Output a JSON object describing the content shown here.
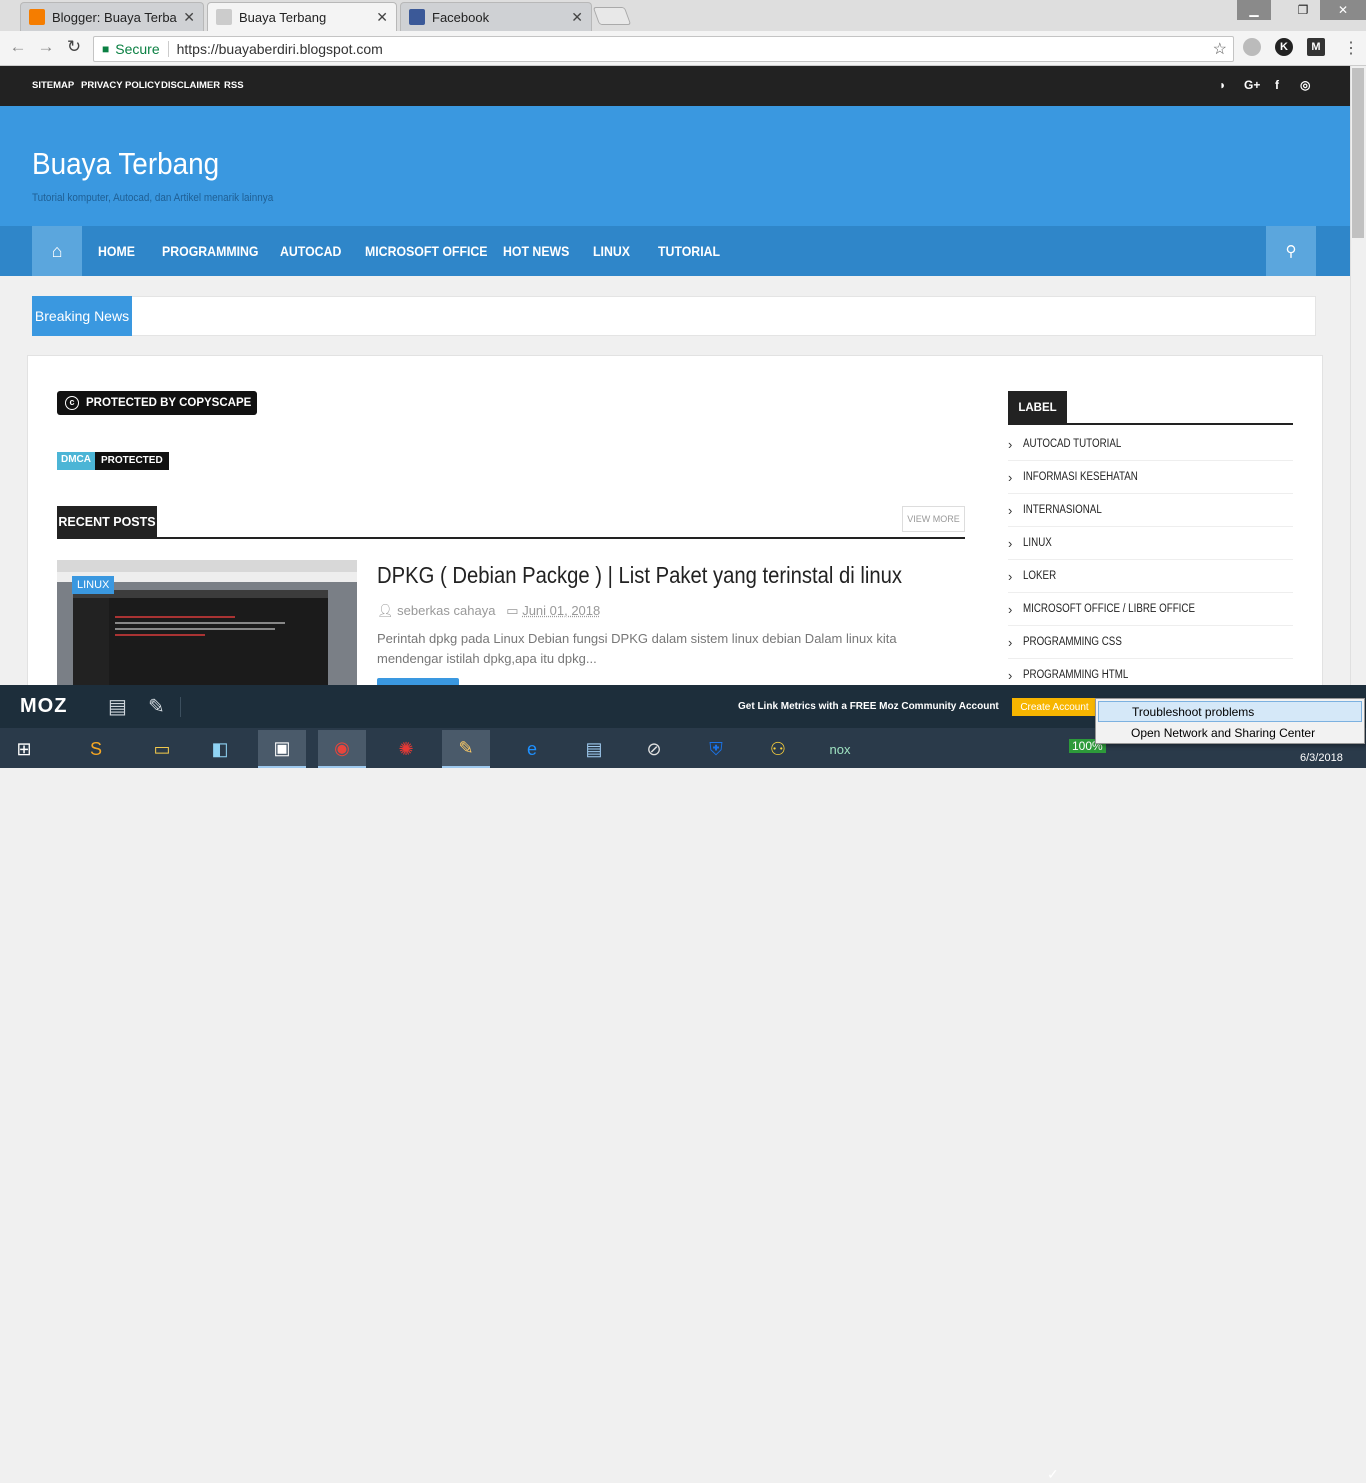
{
  "browser": {
    "tabs": [
      {
        "title": "Blogger: Buaya Terbang -",
        "favicon_color": "#f57d00"
      },
      {
        "title": "Buaya Terbang",
        "favicon_color": "#cccccc"
      },
      {
        "title": "Facebook",
        "favicon_color": "#3b5998"
      }
    ],
    "close_glyph": "✕",
    "secure_label": "Secure",
    "url": "https://buayaberdiri.blogspot.com",
    "extensions": [
      {
        "icon": "globe-icon",
        "color": "#bbbbbb"
      },
      {
        "icon": "k-extension-icon",
        "glyph": "K",
        "color": "#222222"
      },
      {
        "icon": "m-extension-icon",
        "glyph": "M",
        "color": "#333333"
      }
    ]
  },
  "site": {
    "topnav": [
      "SITEMAP",
      "PRIVACY POLICY",
      "DISCLAIMER",
      "RSS"
    ],
    "social": [
      "rss-icon",
      "google-plus-icon",
      "facebook-icon",
      "instagram-icon"
    ],
    "social_glyphs": [
      "◗",
      "G+",
      "f",
      "◎"
    ],
    "title": "Buaya Terbang",
    "tagline": "Tutorial komputer, Autocad, dan Artikel menarik lainnya",
    "menu": [
      "HOME",
      "PROGRAMMING",
      "AUTOCAD",
      "MICROSOFT OFFICE",
      "HOT NEWS",
      "LINUX",
      "TUTORIAL"
    ],
    "breaking_label": "Breaking News",
    "copyscape": "PROTECTED BY COPYSCAPE",
    "dmca": {
      "left": "DMCA",
      "right": "PROTECTED"
    },
    "recent_posts_heading": "RECENT POSTS",
    "view_more": "VIEW MORE",
    "post": {
      "badge": "LINUX",
      "title": "DPKG ( Debian Packge ) | List Paket yang terinstal di linux",
      "author": "seberkas cahaya",
      "date": "Juni 01, 2018",
      "excerpt": "Perintah dpkg pada Linux Debian fungsi DPKG dalam sistem linux debian Dalam linux kita mendengar istilah dpkg,apa itu dpkg..."
    },
    "label_heading": "LABEL",
    "labels": [
      "AUTOCAD TUTORIAL",
      "INFORMASI KESEHATAN",
      "INTERNASIONAL",
      "LINUX",
      "LOKER",
      "MICROSOFT OFFICE / LIBRE OFFICE",
      "PROGRAMMING CSS",
      "PROGRAMMING HTML"
    ]
  },
  "moz": {
    "logo": "MOZ",
    "promo": "Get Link Metrics with a FREE Moz Community Account",
    "cta": "Create Account"
  },
  "taskbar": {
    "battery": "100%",
    "date": "6/3/2018",
    "context_menu": [
      "Troubleshoot problems",
      "Open Network and Sharing Center"
    ]
  }
}
